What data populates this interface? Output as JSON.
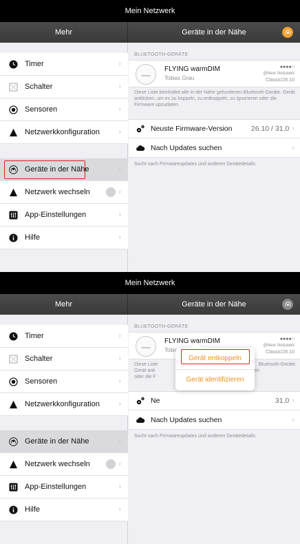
{
  "screens": [
    {
      "titlebar": "Mein Netzwerk",
      "left_header": "Mehr",
      "right_header": "Geräte in der Nähe",
      "menu": [
        {
          "label": "Timer",
          "icon": "clock-icon"
        },
        {
          "label": "Schalter",
          "icon": "switch-icon"
        },
        {
          "label": "Sensoren",
          "icon": "sensor-icon"
        },
        {
          "label": "Netzwerkkonfiguration",
          "icon": "network-config-icon"
        },
        {
          "label": "Geräte in der Nähe",
          "icon": "nearby-devices-icon"
        },
        {
          "label": "Netzwerk wechseln",
          "icon": "network-switch-icon"
        },
        {
          "label": "App-Einstellungen",
          "icon": "app-settings-icon"
        },
        {
          "label": "Hilfe",
          "icon": "help-icon"
        }
      ],
      "bluetooth_header": "BLUETOOTH-GERÄTE",
      "device": {
        "name": "FLYING warmDIM",
        "owner": "Tobias Grau",
        "signal": "●●●●○",
        "network": "@Mein Netzwerk",
        "version": "Classic/26.10"
      },
      "description": "Diese Liste beinhaltet alle in der Nähe gefundenen Bluetooth-Geräte. Gerät anklicken, um es zu koppeln, zu entkoppeln, zu ignorieren oder die Firmware upzudaten.",
      "firmware_label": "Neuste Firmware-Version",
      "firmware_value": "26.10 / 31.0",
      "updates_label": "Nach Updates suchen",
      "footer": "Sucht nach Firmwareupdates und anderen Gerätedetails."
    },
    {
      "titlebar": "Mein Netzwerk",
      "left_header": "Mehr",
      "right_header": "Geräte in der Nähe",
      "menu": [
        {
          "label": "Timer",
          "icon": "clock-icon"
        },
        {
          "label": "Schalter",
          "icon": "switch-icon"
        },
        {
          "label": "Sensoren",
          "icon": "sensor-icon"
        },
        {
          "label": "Netzwerkkonfiguration",
          "icon": "network-config-icon"
        },
        {
          "label": "Geräte in der Nähe",
          "icon": "nearby-devices-icon"
        },
        {
          "label": "Netzwerk wechseln",
          "icon": "network-switch-icon"
        },
        {
          "label": "App-Einstellungen",
          "icon": "app-settings-icon"
        },
        {
          "label": "Hilfe",
          "icon": "help-icon"
        }
      ],
      "bluetooth_header": "BLUETOOTH-GERÄTE",
      "device": {
        "name": "FLYING warmDIM",
        "owner": "Tobias Grau",
        "signal": "●●●●○",
        "network": "@Mein Netzwerk",
        "version": "Classic/26.10"
      },
      "description_visible_left": "Diese Liste",
      "description_visible_right": "Bluetooth-Geräte.",
      "description_line2_left": "Gerät ank",
      "description_line2_right": "eren",
      "description_line3_left": "oder die F",
      "firmware_label_visible": "Ne",
      "firmware_value_visible": "31.0",
      "updates_label": "Nach Updates suchen",
      "footer": "Sucht nach Firmwareupdates und anderen Gerätedetails.",
      "popover": {
        "unpair": "Gerät entkoppeln",
        "identify": "Gerät identifizieren"
      }
    }
  ],
  "colors": {
    "accent": "#f0901a",
    "highlight": "#e02020",
    "header_bg": "#424242",
    "titlebar_bg": "#000000"
  }
}
